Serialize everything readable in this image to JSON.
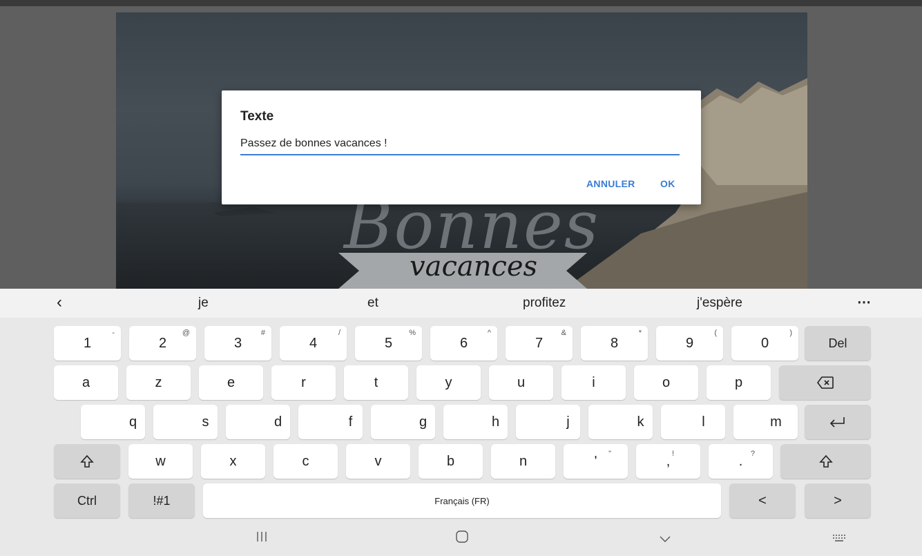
{
  "dialog": {
    "title": "Texte",
    "input_value": "Passez de bonnes vacances !",
    "cancel_label": "ANNULER",
    "ok_label": "OK"
  },
  "background": {
    "big_word": "Bonnes",
    "small_word": "vacances"
  },
  "suggestions": {
    "back_icon": "chevron-left",
    "items": [
      "je",
      "et",
      "profitez",
      "j'espère"
    ],
    "more_icon": "more-horizontal"
  },
  "keyboard": {
    "row1": [
      {
        "main": "1",
        "sup": "-"
      },
      {
        "main": "2",
        "sup": "@"
      },
      {
        "main": "3",
        "sup": "#"
      },
      {
        "main": "4",
        "sup": "/"
      },
      {
        "main": "5",
        "sup": "%"
      },
      {
        "main": "6",
        "sup": "^"
      },
      {
        "main": "7",
        "sup": "&"
      },
      {
        "main": "8",
        "sup": "*"
      },
      {
        "main": "9",
        "sup": "("
      },
      {
        "main": "0",
        "sup": ")"
      }
    ],
    "del_label": "Del",
    "row2": [
      "a",
      "z",
      "e",
      "r",
      "t",
      "y",
      "u",
      "i",
      "o",
      "p"
    ],
    "row3": [
      "q",
      "s",
      "d",
      "f",
      "g",
      "h",
      "j",
      "k",
      "l",
      "m"
    ],
    "row4": [
      "w",
      "x",
      "c",
      "v",
      "b",
      "n"
    ],
    "punct": [
      {
        "main": "'",
        "sup": "\""
      },
      {
        "main": ",",
        "sup": "!"
      },
      {
        "main": ".",
        "sup": "?"
      }
    ],
    "ctrl_label": "Ctrl",
    "symbols_label": "!#1",
    "space_label": "Français (FR)",
    "left_arrow": "<",
    "right_arrow": ">"
  },
  "colors": {
    "accent": "#3a7bd5",
    "keyboard_bg": "#e8e8e8",
    "key_bg": "#ffffff",
    "fn_key_bg": "#d4d4d4"
  }
}
